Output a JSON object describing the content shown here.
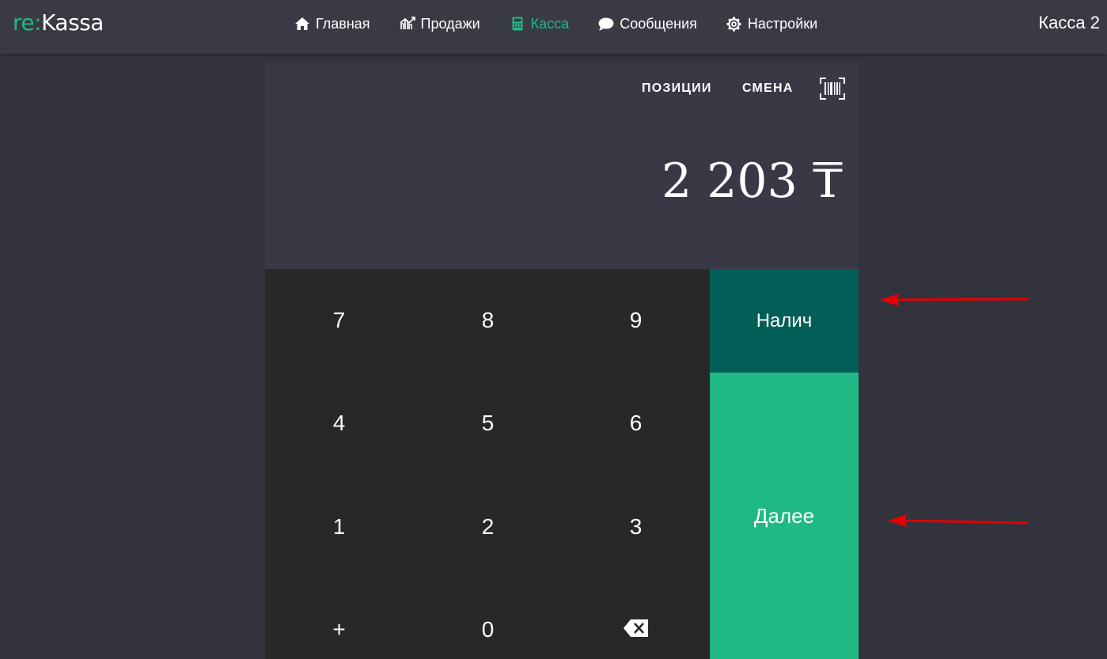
{
  "app": {
    "logo_prefix": "re:",
    "logo_name": "Kassa",
    "kassa_name": "Касса 2"
  },
  "nav": {
    "items": [
      {
        "label": "Главная",
        "icon": "home-icon"
      },
      {
        "label": "Продажи",
        "icon": "sales-chart-icon"
      },
      {
        "label": "Касса",
        "icon": "calculator-icon",
        "active": true
      },
      {
        "label": "Сообщения",
        "icon": "message-icon"
      },
      {
        "label": "Настройки",
        "icon": "gear-icon"
      }
    ]
  },
  "register": {
    "tabs": {
      "positions": "ПОЗИЦИИ",
      "shift": "СМЕНА"
    },
    "barcode_icon": "barcode-scan-icon",
    "amount": "2 203 ₸"
  },
  "keypad": {
    "keys": [
      "7",
      "8",
      "9",
      "4",
      "5",
      "6",
      "1",
      "2",
      "3",
      "+",
      "0",
      ""
    ],
    "backspace_icon": "backspace-icon"
  },
  "actions": {
    "cash_label": "Налич",
    "next_label": "Далее"
  },
  "colors": {
    "accent": "#1fb985",
    "cash_button": "#045e58",
    "annotation_arrow": "#e50000"
  }
}
